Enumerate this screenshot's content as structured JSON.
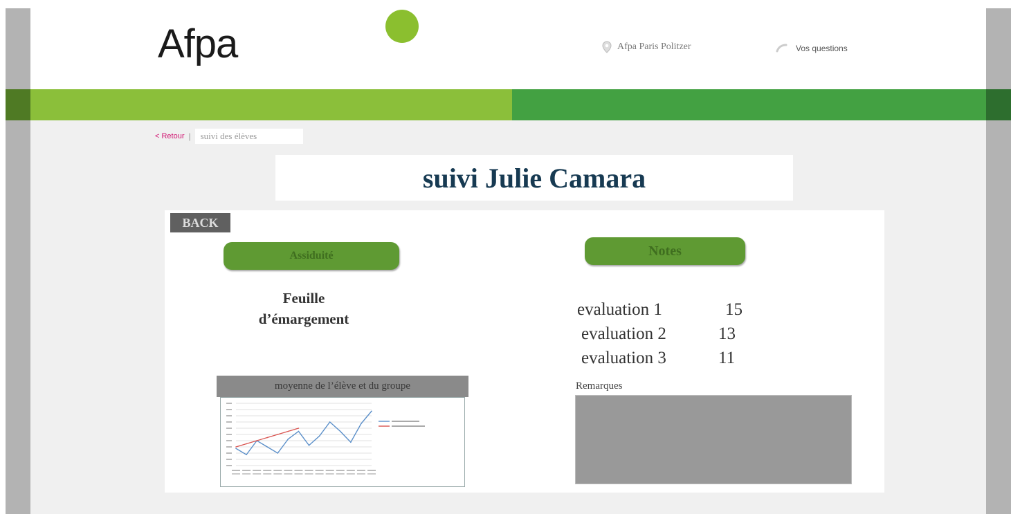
{
  "header": {
    "logo_text": "Afpa",
    "location": "Afpa Paris Politzer",
    "questions": "Vos questions"
  },
  "colors": {
    "brand_light_green": "#8bbf3a",
    "brand_dark_green": "#43a142",
    "retour_pink": "#d0126f",
    "title_blue": "#173a52"
  },
  "breadcrumb": {
    "retour": "< Retour",
    "separator": "|",
    "current": "suivi des élèves"
  },
  "page_title": "suivi Julie Camara",
  "back_button": "BACK",
  "left": {
    "assiduite_button": "Assiduité",
    "feuille_line1": "Feuille",
    "feuille_line2": "d’émargement",
    "chart_title": "moyenne de l’élève et du groupe"
  },
  "right": {
    "notes_button": "Notes",
    "grades": [
      {
        "name": "evaluation 1",
        "score": "15"
      },
      {
        "name": "evaluation 2",
        "score": "13"
      },
      {
        "name": "evaluation 3",
        "score": "11"
      }
    ],
    "remarques_label": "Remarques"
  },
  "icons": {
    "location": "map-pin-icon",
    "questions": "phone-icon"
  },
  "chart_data": {
    "type": "line",
    "title": "moyenne de l’élève et du groupe",
    "x": [
      1,
      2,
      3,
      4,
      5,
      6,
      7,
      8,
      9,
      10,
      11,
      12,
      13,
      14
    ],
    "series": [
      {
        "color": "#5b8fc9",
        "values": [
          55,
          35,
          80,
          60,
          40,
          85,
          110,
          65,
          95,
          140,
          110,
          75,
          135,
          175
        ]
      },
      {
        "color": "#d9534f",
        "values": [
          60,
          70,
          80,
          90,
          100,
          110,
          120
        ]
      }
    ],
    "ylim": [
      0,
      200
    ],
    "grid": true,
    "legend": "right"
  }
}
